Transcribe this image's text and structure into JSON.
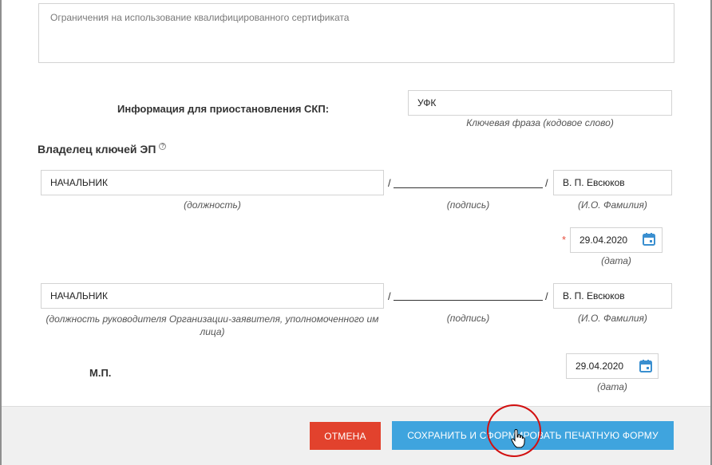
{
  "restrictions": {
    "placeholder": "Ограничения на использование квалифицированного сертификата"
  },
  "suspension": {
    "label": "Информация для приостановления СКП:",
    "value": "УФК",
    "caption": "Ключевая фраза (кодовое слово)"
  },
  "key_owner": {
    "heading": "Владелец ключей ЭП",
    "help_icon": "?",
    "position_value": "НАЧАЛЬНИК",
    "position_caption": "(должность)",
    "slash": "/",
    "signature_caption": "(подпись)",
    "name_value": "В. П. Евсюков",
    "name_caption": "(И.О. Фамилия)",
    "required_mark": "*",
    "date_value": "29.04.2020",
    "date_caption": "(дата)"
  },
  "head_of_org": {
    "position_value": "НАЧАЛЬНИК",
    "position_caption": "(должность руководителя Организации-заявителя, уполномоченного им лица)",
    "slash": "/",
    "signature_caption": "(подпись)",
    "name_value": "В. П. Евсюков",
    "name_caption": "(И.О. Фамилия)"
  },
  "stamp": {
    "label": "М.П.",
    "date_value": "29.04.2020",
    "date_caption": "(дата)"
  },
  "footer": {
    "cancel_label": "ОТМЕНА",
    "save_label": "СОХРАНИТЬ И СФОРМИРОВАТЬ ПЕЧАТНУЮ ФОРМУ"
  },
  "colors": {
    "cancel_button": "#e2422d",
    "save_button": "#3fa4de",
    "calendar_icon": "#3a8fd0",
    "required": "#e74c3c",
    "annotation_circle": "#d21010"
  },
  "icons": {
    "help": "help-icon",
    "calendar": "calendar-icon",
    "cursor": "hand-cursor-icon"
  }
}
